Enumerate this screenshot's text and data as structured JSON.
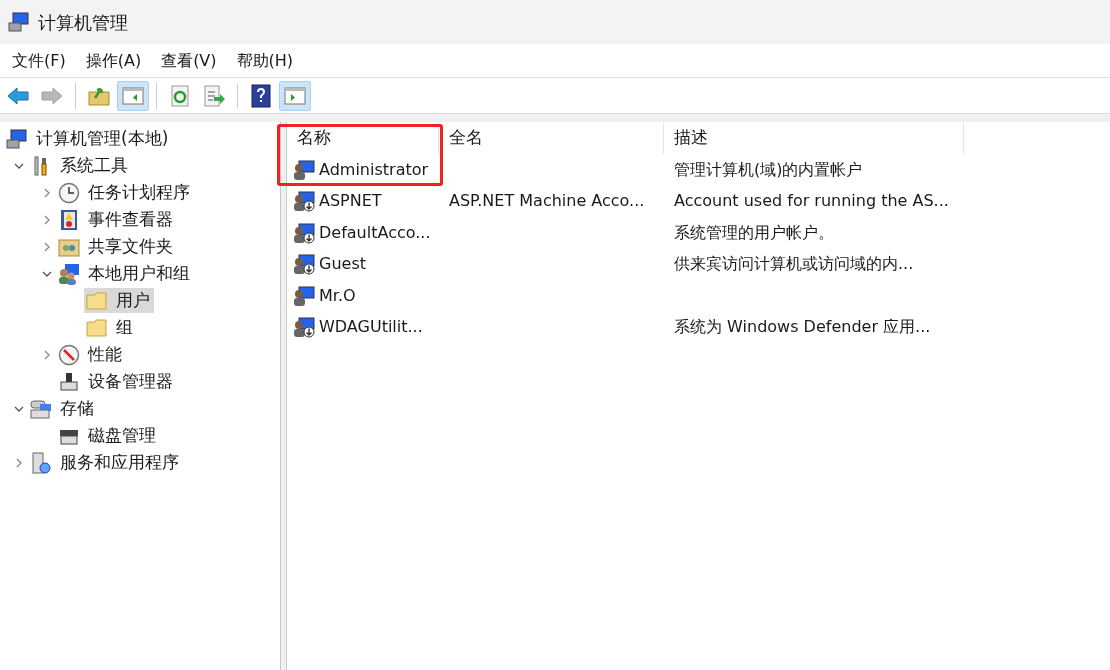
{
  "window": {
    "title": "计算机管理"
  },
  "menu": [
    "文件(F)",
    "操作(A)",
    "查看(V)",
    "帮助(H)"
  ],
  "toolbar": [
    {
      "kind": "back",
      "disabled": false,
      "selected": false
    },
    {
      "kind": "forward",
      "disabled": true,
      "selected": false
    },
    {
      "kind": "separator"
    },
    {
      "kind": "up",
      "disabled": false,
      "selected": false
    },
    {
      "kind": "tree-toggle",
      "disabled": false,
      "selected": true
    },
    {
      "kind": "separator"
    },
    {
      "kind": "refresh",
      "disabled": false,
      "selected": false
    },
    {
      "kind": "export",
      "disabled": false,
      "selected": false
    },
    {
      "kind": "separator"
    },
    {
      "kind": "help",
      "disabled": false,
      "selected": false
    },
    {
      "kind": "pane-toggle",
      "disabled": false,
      "selected": true
    }
  ],
  "tree": [
    {
      "label": "计算机管理(本地)",
      "selected": false,
      "children": [
        {
          "label": "系统工具",
          "expanded": true,
          "selected": false,
          "children": [
            {
              "label": "任务计划程序",
              "expanded": false,
              "selected": false
            },
            {
              "label": "事件查看器",
              "expanded": false,
              "selected": false
            },
            {
              "label": "共享文件夹",
              "expanded": false,
              "selected": false
            },
            {
              "label": "本地用户和组",
              "expanded": true,
              "selected": false,
              "children": [
                {
                  "label": "用户",
                  "selected": true
                },
                {
                  "label": "组",
                  "selected": false
                }
              ]
            },
            {
              "label": "性能",
              "expanded": false,
              "selected": false
            },
            {
              "label": "设备管理器",
              "selected": false
            }
          ]
        },
        {
          "label": "存储",
          "expanded": true,
          "selected": false,
          "children": [
            {
              "label": "磁盘管理",
              "selected": false
            }
          ]
        },
        {
          "label": "服务和应用程序",
          "expanded": false,
          "selected": false
        }
      ]
    }
  ],
  "table": {
    "columns": [
      "名称",
      "全名",
      "描述"
    ],
    "rows": [
      {
        "name": "Administrator",
        "full_name": "",
        "description": "管理计算机(域)的内置帐户",
        "disabled": false,
        "highlighted": true
      },
      {
        "name": "ASPNET",
        "full_name": "ASP.NET Machine Acco...",
        "description": "Account used for running the AS...",
        "disabled": true,
        "highlighted": false
      },
      {
        "name": "DefaultAcco...",
        "full_name": "",
        "description": "系统管理的用户帐户。",
        "disabled": true,
        "highlighted": false
      },
      {
        "name": "Guest",
        "full_name": "",
        "description": "供来宾访问计算机或访问域的内...",
        "disabled": true,
        "highlighted": false
      },
      {
        "name": "Mr.O",
        "full_name": "",
        "description": "",
        "disabled": false,
        "highlighted": false
      },
      {
        "name": "WDAGUtilit...",
        "full_name": "",
        "description": "系统为 Windows Defender 应用...",
        "disabled": true,
        "highlighted": false
      }
    ]
  }
}
